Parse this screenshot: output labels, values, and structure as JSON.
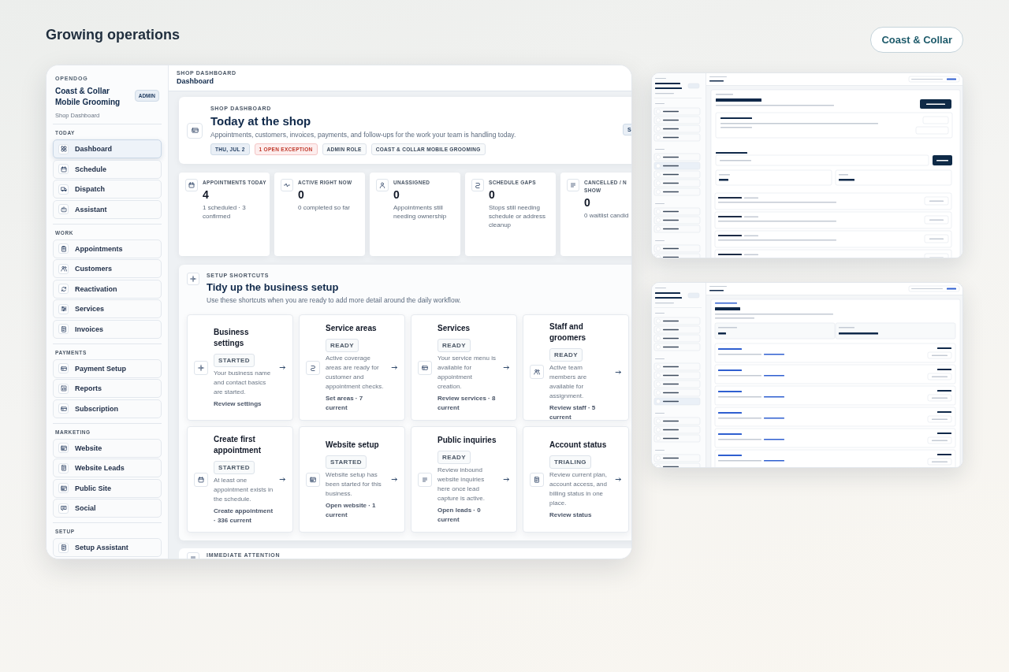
{
  "page": {
    "title": "Growing operations",
    "brand_pill": "Coast & Collar"
  },
  "main": {
    "sidebar": {
      "org": "OPENDOG",
      "business": "Coast & Collar Mobile Grooming",
      "role_badge": "ADMIN",
      "subtitle": "Shop Dashboard",
      "groups": [
        {
          "label": "TODAY",
          "items": [
            {
              "label": "Dashboard",
              "selected": true
            },
            {
              "label": "Schedule",
              "selected": false
            },
            {
              "label": "Dispatch",
              "selected": false
            },
            {
              "label": "Assistant",
              "selected": false
            }
          ]
        },
        {
          "label": "WORK",
          "items": [
            {
              "label": "Appointments",
              "selected": false
            },
            {
              "label": "Customers",
              "selected": false
            },
            {
              "label": "Reactivation",
              "selected": false
            },
            {
              "label": "Services",
              "selected": false
            },
            {
              "label": "Invoices",
              "selected": false
            }
          ]
        },
        {
          "label": "PAYMENTS",
          "items": [
            {
              "label": "Payment Setup",
              "selected": false
            },
            {
              "label": "Reports",
              "selected": false
            },
            {
              "label": "Subscription",
              "selected": false
            }
          ]
        },
        {
          "label": "MARKETING",
          "items": [
            {
              "label": "Website",
              "selected": false
            },
            {
              "label": "Website Leads",
              "selected": false
            },
            {
              "label": "Public Site",
              "selected": false
            },
            {
              "label": "Social",
              "selected": false
            }
          ]
        },
        {
          "label": "SETUP",
          "items": [
            {
              "label": "Setup Assistant",
              "selected": false
            }
          ]
        }
      ]
    },
    "topbar": {
      "eyebrow": "SHOP DASHBOARD",
      "title": "Dashboard"
    },
    "hero": {
      "eyebrow": "SHOP DASHBOARD",
      "title": "Today at the shop",
      "description": "Appointments, customers, invoices, payments, and follow-ups for the work your team is handling today.",
      "side_badge": "S",
      "tags": [
        {
          "text": "THU, JUL 2",
          "kind": "date"
        },
        {
          "text": "1 OPEN EXCEPTION",
          "kind": "alert"
        },
        {
          "text": "ADMIN ROLE",
          "kind": "neutral"
        },
        {
          "text": "COAST & COLLAR MOBILE GROOMING",
          "kind": "neutral"
        }
      ]
    },
    "stats": [
      {
        "label": "APPOINTMENTS TODAY",
        "value": "4",
        "note": "1 scheduled · 3 confirmed"
      },
      {
        "label": "ACTIVE RIGHT NOW",
        "value": "0",
        "note": "0 completed so far"
      },
      {
        "label": "UNASSIGNED",
        "value": "0",
        "note": "Appointments still needing ownership"
      },
      {
        "label": "SCHEDULE GAPS",
        "value": "0",
        "note": "Stops still needing schedule or address cleanup"
      },
      {
        "label": "CANCELLED / N",
        "label_2": "SHOW",
        "value": "0",
        "note": "0 waitlist candid"
      }
    ],
    "setup": {
      "eyebrow": "SETUP SHORTCUTS",
      "title": "Tidy up the business setup",
      "description": "Use these shortcuts when you are ready to add more detail around the daily workflow.",
      "cards": [
        {
          "title": "Business settings",
          "status": "STARTED",
          "description": "Your business name and contact basics are started.",
          "action": "Review settings"
        },
        {
          "title": "Service areas",
          "status": "READY",
          "description": "Active coverage areas are ready for customer and appointment checks.",
          "action": "Set areas · 7 current"
        },
        {
          "title": "Services",
          "status": "READY",
          "description": "Your service menu is available for appointment creation.",
          "action": "Review services · 8 current"
        },
        {
          "title": "Staff and groomers",
          "status": "READY",
          "description": "Active team members are available for assignment.",
          "action": "Review staff · 5 current"
        },
        {
          "title": "Create first appointment",
          "status": "STARTED",
          "description": "At least one appointment exists in the schedule.",
          "action": "Create appointment · 336 current"
        },
        {
          "title": "Website setup",
          "status": "STARTED",
          "description": "Website setup has been started for this business.",
          "action": "Open website · 1 current"
        },
        {
          "title": "Public inquiries",
          "status": "READY",
          "description": "Review inbound website inquiries here once lead capture is active.",
          "action": "Open leads · 0 current"
        },
        {
          "title": "Account status",
          "status": "TRIALING",
          "description": "Review current plan, account access, and billing status in one place.",
          "action": "Review status"
        }
      ]
    },
    "attention": {
      "eyebrow": "IMMEDIATE ATTENTION"
    }
  },
  "thumbnails": [
    {
      "kind": "customers"
    },
    {
      "kind": "invoices"
    }
  ]
}
